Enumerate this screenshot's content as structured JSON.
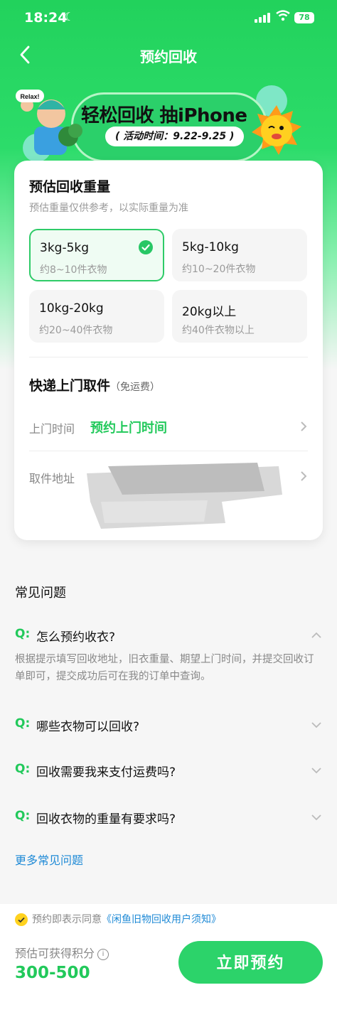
{
  "status_bar": {
    "time": "18:24",
    "battery": "78"
  },
  "header": {
    "title": "预约回收"
  },
  "banner": {
    "headline": "轻松回收 抽iPhone",
    "date_range": "( 活动时间：9.22-9.25 )",
    "mascot_tag": "Relax!"
  },
  "weight": {
    "title": "预估回收重量",
    "subtitle": "预估重量仅供参考，以实际重量为准",
    "options": [
      {
        "weight": "3kg-5kg",
        "desc": "约8~10件衣物",
        "selected": true
      },
      {
        "weight": "5kg-10kg",
        "desc": "约10~20件衣物",
        "selected": false
      },
      {
        "weight": "10kg-20kg",
        "desc": "约20~40件衣物",
        "selected": false
      },
      {
        "weight": "20kg以上",
        "desc": "约40件衣物以上",
        "selected": false
      }
    ]
  },
  "pickup": {
    "title": "快递上门取件",
    "note": "（免运费）",
    "time_label": "上门时间",
    "time_value": "预约上门时间",
    "address_label": "取件地址"
  },
  "faq": {
    "title": "常见问题",
    "q_mark": "Q:",
    "items": [
      {
        "q": "怎么预约收衣?",
        "a": "根据提示填写回收地址，旧衣重量、期望上门时间，并提交回收订单即可，提交成功后可在我的订单中查询。",
        "expanded": true
      },
      {
        "q": "哪些衣物可以回收?",
        "expanded": false
      },
      {
        "q": "回收需要我来支付运费吗?",
        "expanded": false
      },
      {
        "q": "回收衣物的重量有要求吗?",
        "expanded": false
      }
    ],
    "more": "更多常见问题"
  },
  "footer": {
    "agree_text": "预约即表示同意",
    "agree_link": "《闲鱼旧物回收用户须知》",
    "points_label": "预估可获得积分",
    "points_value": "300-500",
    "submit": "立即预约"
  },
  "colors": {
    "brand": "#22c95b",
    "link": "#1f8ad6"
  }
}
